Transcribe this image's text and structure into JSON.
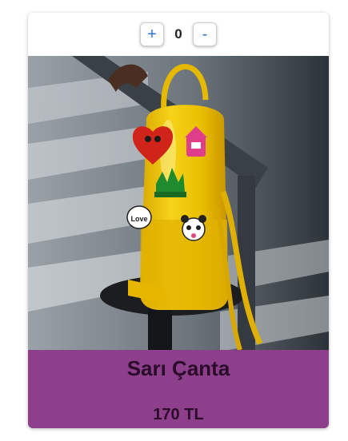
{
  "stepper": {
    "plus_label": "+",
    "count": "0",
    "minus_label": "-"
  },
  "product": {
    "title": "Sarı Çanta",
    "price": "170 TL",
    "pin_label": "Love"
  },
  "colors": {
    "caption_bg": "#8e3f8c",
    "button_text": "#2f6fd6",
    "bag_yellow": "#f2c500"
  }
}
